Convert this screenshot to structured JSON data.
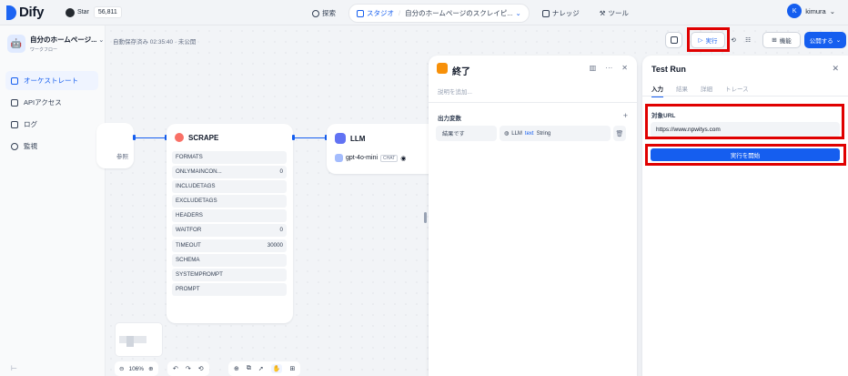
{
  "brand": {
    "name": "Dify",
    "github_label": "Star",
    "github_count": "56,811"
  },
  "topnav": {
    "explore": "探索",
    "studio": "スタジオ",
    "studio_app": "自分のホームページのスクレイピ...",
    "knowledge": "ナレッジ",
    "tools": "ツール"
  },
  "user": {
    "initial": "K",
    "name": "kimura"
  },
  "app": {
    "name": "自分のホームページ...",
    "type": "ワークフロー"
  },
  "sidebar": {
    "items": [
      {
        "label": "オーケストレート",
        "icon": "layout-icon",
        "active": true
      },
      {
        "label": "APIアクセス",
        "icon": "terminal-icon",
        "active": false
      },
      {
        "label": "ログ",
        "icon": "file-icon",
        "active": false
      },
      {
        "label": "監視",
        "icon": "monitor-icon",
        "active": false
      }
    ]
  },
  "canvas": {
    "autosave": "自動保存済み 02:35:40 · 未公開",
    "left_node_fragment": "参照",
    "scrape": {
      "title": "SCRAPE",
      "params": [
        {
          "name": "FORMATS",
          "value": ""
        },
        {
          "name": "ONLYMAINCON...",
          "value": "0"
        },
        {
          "name": "INCLUDETAGS",
          "value": ""
        },
        {
          "name": "EXCLUDETAGS",
          "value": ""
        },
        {
          "name": "HEADERS",
          "value": ""
        },
        {
          "name": "WAITFOR",
          "value": "0"
        },
        {
          "name": "TIMEOUT",
          "value": "30000"
        },
        {
          "name": "SCHEMA",
          "value": ""
        },
        {
          "name": "SYSTEMPROMPT",
          "value": ""
        },
        {
          "name": "PROMPT",
          "value": ""
        }
      ]
    },
    "llm": {
      "title": "LLM",
      "model": "gpt-4o-mini",
      "mode": "CHAT"
    },
    "zoom": "106%"
  },
  "header_buttons": {
    "run": "実行",
    "features": "機能",
    "publish": "公開する"
  },
  "end_panel": {
    "title": "終了",
    "description_placeholder": "説明を追加...",
    "output_label": "出力変数",
    "output": {
      "name": "結果です",
      "node": "LLM",
      "var": "text",
      "type": "String"
    }
  },
  "test_run": {
    "title": "Test Run",
    "tabs": [
      "入力",
      "結果",
      "詳細",
      "トレース"
    ],
    "field_label": "対象URL",
    "field_value": "https://www.npwitys.com",
    "start_button": "実行を開始"
  },
  "colors": {
    "accent": "#155eef",
    "highlight": "#e00000"
  }
}
